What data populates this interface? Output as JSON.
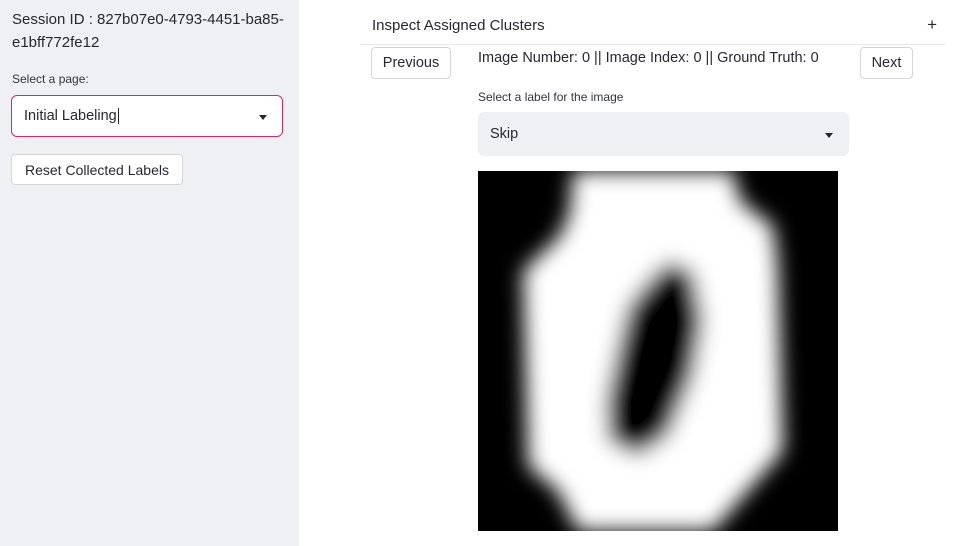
{
  "sidebar": {
    "session_label": "Session ID : 827b07e0-4793-4451-ba85-e1bff772fe12",
    "select_label": "Select a page:",
    "page_select_value": "Initial Labeling",
    "reset_button_label": "Reset Collected Labels"
  },
  "main": {
    "expander_title": "Inspect Assigned Clusters",
    "expander_icon": "+",
    "previous_label": "Previous",
    "next_label": "Next",
    "image_info": "Image Number: 0 || Image Index: 0 || Ground Truth: 0",
    "label_select_label": "Select a label for the image",
    "label_select_value": "Skip"
  },
  "colors": {
    "sidebar_bg": "#eff0f4",
    "focus_border": "#e0245e",
    "select_bg": "#eff0f4"
  }
}
